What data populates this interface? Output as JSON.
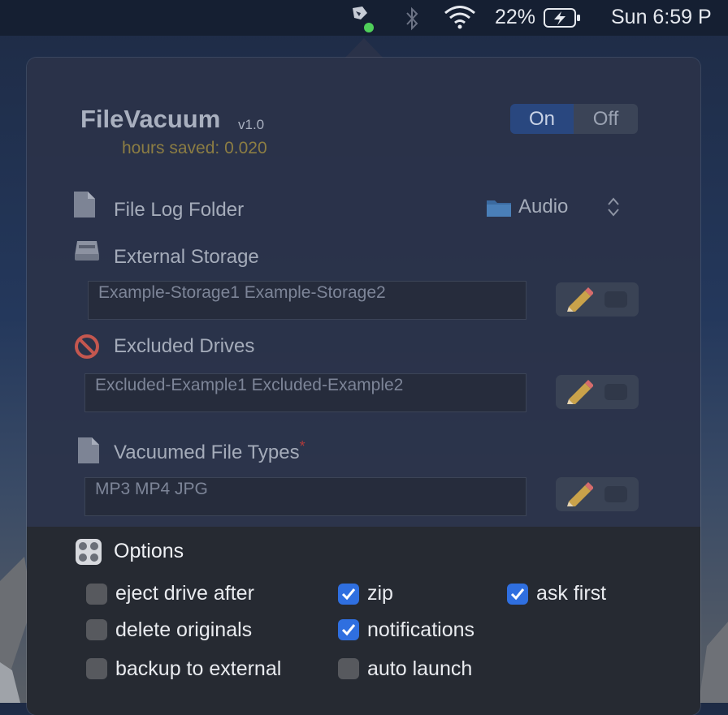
{
  "menubar": {
    "battery_percent": "22%",
    "clock": "Sun 6:59 P",
    "icons": [
      "filevacuum-app-icon",
      "bluetooth-icon",
      "wifi-icon",
      "battery-charging-icon"
    ]
  },
  "app": {
    "title": "FileVacuum",
    "version": "v1.0",
    "hours_saved": "hours saved: 0.020",
    "toggle": {
      "on_label": "On",
      "off_label": "Off",
      "selected": "On"
    }
  },
  "file_log": {
    "label": "File Log Folder",
    "selected_folder": "Audio"
  },
  "external_storage": {
    "label": "External Storage",
    "value": "Example-Storage1 Example-Storage2"
  },
  "excluded_drives": {
    "label": "Excluded Drives",
    "value": "Excluded-Example1 Excluded-Example2"
  },
  "file_types": {
    "label": "Vacuumed File Types",
    "required_marker": "*",
    "value": "MP3 MP4 JPG"
  },
  "options": {
    "title": "Options",
    "items": [
      {
        "label": "eject drive after",
        "checked": false
      },
      {
        "label": "zip",
        "checked": true
      },
      {
        "label": "ask first",
        "checked": true
      },
      {
        "label": "delete originals",
        "checked": false
      },
      {
        "label": "notifications",
        "checked": true
      },
      {
        "label": "backup to external",
        "checked": false
      },
      {
        "label": "auto launch",
        "checked": false
      }
    ]
  },
  "colors": {
    "accent": "#2f6fe0",
    "segment_selected": "#29477f",
    "hours_text": "#8c7d43",
    "required_marker": "#b03a3a"
  }
}
